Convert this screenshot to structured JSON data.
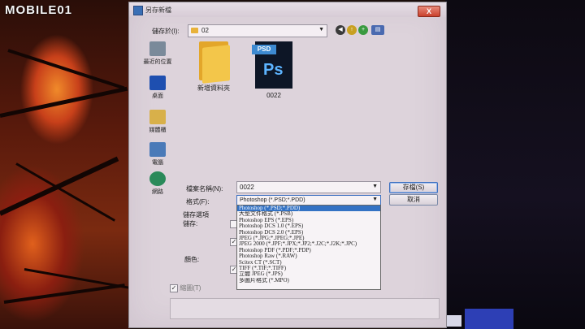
{
  "watermark": {
    "brand": "MOBILE01"
  },
  "dialog": {
    "title": "另存新檔",
    "close": "X",
    "save_in": {
      "label": "儲存於(I):",
      "value": "02",
      "arrow": "▼"
    }
  },
  "places": [
    {
      "label": "最近的位置",
      "color": "#7a8a9a"
    },
    {
      "label": "桌面",
      "color": "#1e4fb0"
    },
    {
      "label": "媒體櫃",
      "color": "#d8b04a"
    },
    {
      "label": "電腦",
      "color": "#4a7ab8"
    },
    {
      "label": "網路",
      "color": "#2a8a5a"
    }
  ],
  "files": [
    {
      "name": "新增資料夾",
      "type": "folder"
    },
    {
      "name": "0022",
      "type": "psd",
      "tag": "PSD",
      "glyph": "Ps"
    }
  ],
  "filename": {
    "label": "檔案名稱(N):",
    "value": "0022",
    "arrow": "▼"
  },
  "format": {
    "label": "格式(F):",
    "value": "Photoshop (*.PSD;*.PDD)",
    "arrow": "▼"
  },
  "buttons": {
    "save": "存檔(S)",
    "cancel": "取消"
  },
  "format_options": [
    "Photoshop (*.PSD;*.PDD)",
    "大型文件格式 (*.PSB)",
    "Photoshop EPS (*.EPS)",
    "Photoshop DCS 1.0 (*.EPS)",
    "Photoshop DCS 2.0 (*.EPS)",
    "JPEG (*.JPG;*.JPEG;*.JPE)",
    "JPEG 2000 (*.JPF;*.JPX;*.JP2;*.J2C;*.J2K;*.JPC)",
    "Photoshop PDF (*.PDF;*.PDP)",
    "Photoshop Raw (*.RAW)",
    "Scitex CT (*.SCT)",
    "TIFF (*.TIF;*.TIFF)",
    "立體 JPEG (*.JPS)",
    "多圖片格式 (*.MPO)"
  ],
  "save_options": {
    "header": "儲存選項",
    "save_label": "儲存:",
    "color_label": "顏色:",
    "thumbnail_label": "縮圖(T)"
  }
}
